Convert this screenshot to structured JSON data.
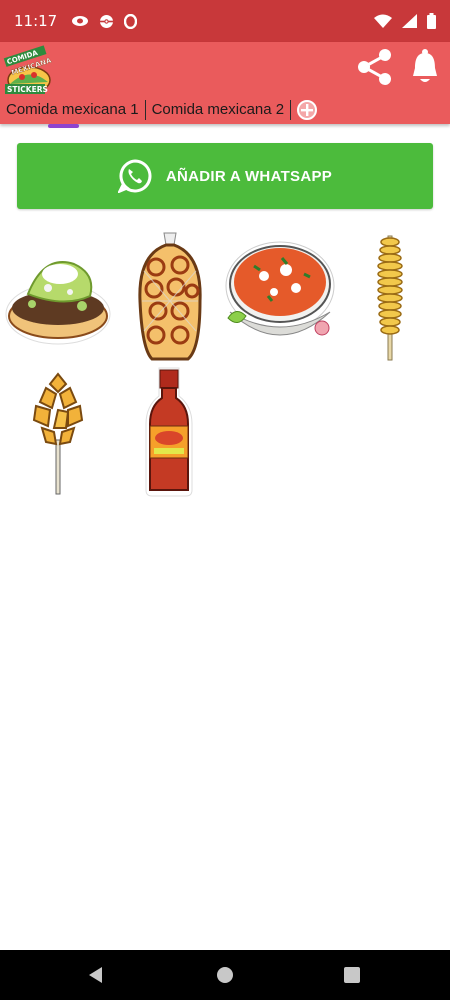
{
  "status_bar": {
    "time": "11:17",
    "left_icons": [
      "incognito-icon",
      "pokeball-icon",
      "opera-icon"
    ],
    "right_icons": [
      "wifi-icon",
      "signal-icon",
      "battery-icon"
    ]
  },
  "header": {
    "logo_text": [
      "COMIDA",
      "MEXICANA",
      "STICKERS"
    ],
    "tabs": [
      {
        "label": "Comida mexicana 1",
        "active": true
      },
      {
        "label": "Comida mexicana 2",
        "active": false
      }
    ],
    "actions": [
      "share-icon",
      "bell-icon",
      "add-tab-icon"
    ],
    "colors": {
      "header": "#ea5b5c",
      "status": "#c8383a",
      "indicator": "#8e44cf"
    }
  },
  "whatsapp": {
    "label": "AÑADIR A WHATSAPP",
    "color": "#4cbb3c"
  },
  "stickers": [
    {
      "name": "tostada"
    },
    {
      "name": "chicharrones-bag"
    },
    {
      "name": "pozole-bowl"
    },
    {
      "name": "spiral-potato-stick"
    },
    {
      "name": "corn-elote-on-stick"
    },
    {
      "name": "hot-sauce-bottle"
    }
  ],
  "nav_bar": {
    "buttons": [
      "back-icon",
      "home-icon",
      "recents-icon"
    ]
  }
}
